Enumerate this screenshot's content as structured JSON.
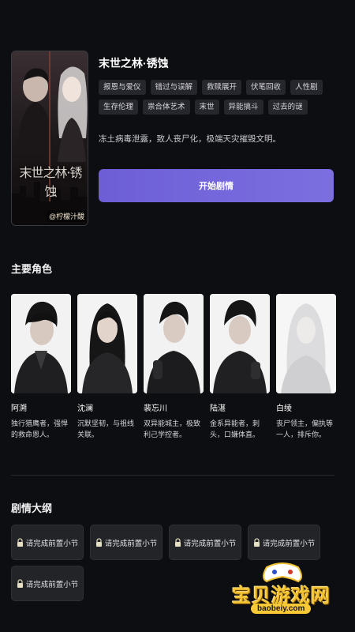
{
  "book": {
    "title": "末世之林·锈蚀",
    "cover_title": "末世之林·锈蚀",
    "cover_author": "@柠檬汁酸",
    "tags": [
      "报恩与爱仪",
      "错过与误解",
      "救赎展开",
      "伏笔回收",
      "人性剧",
      "生存伦理",
      "祟合体艺术",
      "末世",
      "异能搞斗",
      "过去的谜"
    ],
    "description": "冻土病毒泄露，致人丧尸化，极端天灾摧毁文明。",
    "start_label": "开始剧情"
  },
  "characters_section": {
    "title": "主要角色",
    "items": [
      {
        "name": "阿溯",
        "desc": "独行猎鹰者，强悍的救命恩人。"
      },
      {
        "name": "沈澜",
        "desc": "沉默坚韧，与祖线关联。"
      },
      {
        "name": "裴忘川",
        "desc": "双异能城主，极致利己学控者。"
      },
      {
        "name": "陆湛",
        "desc": "金系异能者，刺头，口嫌体直。"
      },
      {
        "name": "白绫",
        "desc": "丧尸领主，偏执等一人，排斥你。"
      }
    ]
  },
  "plot_section": {
    "title": "剧情大纲",
    "chapters": [
      "请完成前置小节",
      "请完成前置小节",
      "请完成前置小节",
      "请完成前置小节",
      "请完成前置小节"
    ]
  },
  "watermark": {
    "text": "宝贝游戏网",
    "url": "baobeiy.com"
  },
  "colors": {
    "accent": "#7569dc",
    "background": "#0d0e11",
    "tag_bg": "#26272c"
  }
}
